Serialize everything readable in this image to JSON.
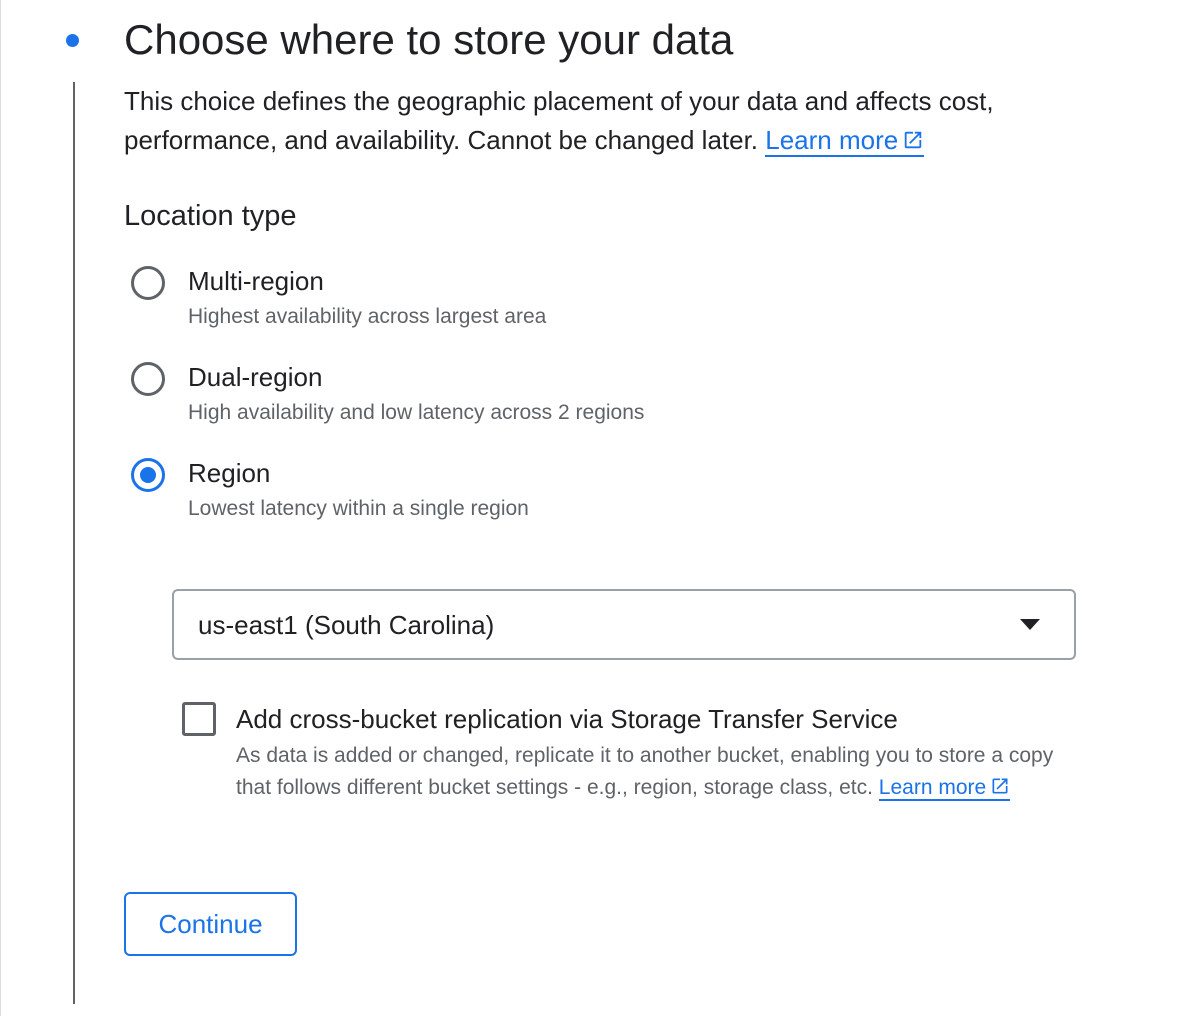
{
  "step": {
    "title": "Choose where to store your data",
    "description": "This choice defines the geographic placement of your data and affects cost, performance, and availability. Cannot be changed later.",
    "learn_more": "Learn more"
  },
  "location_type": {
    "heading": "Location type",
    "options": [
      {
        "label": "Multi-region",
        "sublabel": "Highest availability across largest area",
        "selected": false
      },
      {
        "label": "Dual-region",
        "sublabel": "High availability and low latency across 2 regions",
        "selected": false
      },
      {
        "label": "Region",
        "sublabel": "Lowest latency within a single region",
        "selected": true
      }
    ]
  },
  "region_select": {
    "value": "us-east1 (South Carolina)"
  },
  "replication": {
    "checked": false,
    "label": "Add cross-bucket replication via Storage Transfer Service",
    "description": "As data is added or changed, replicate it to another bucket, enabling you to store a copy that follows different bucket settings - e.g., region, storage class, etc.",
    "learn_more": "Learn more"
  },
  "actions": {
    "continue_label": "Continue"
  },
  "colors": {
    "accent": "#1a73e8",
    "text": "#202124",
    "secondary_text": "#5f6368"
  },
  "icons": {
    "step_indicator": "step-dot-icon",
    "external_link": "open-in-new-icon",
    "dropdown": "arrow-drop-down-icon"
  }
}
